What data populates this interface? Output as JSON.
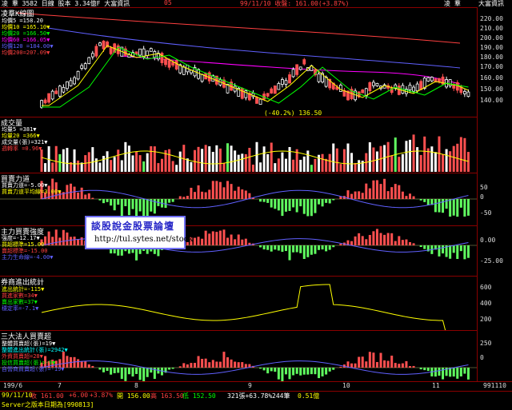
{
  "titlebar": {
    "left": "凌  羣 3582 日線 股本 3.34億F 大富資訊",
    "code": "05",
    "date_price": "99/11/10 收盤: 161.00(+3.87%)",
    "right1": "凌  羣",
    "right2": "大富資訊"
  },
  "panels": {
    "price": {
      "title": "凌羣K線圖",
      "legend": [
        {
          "text": "均價5 =158.20",
          "color": "#ffffff"
        },
        {
          "text": "均價10 =165.10▼",
          "color": "#ffff00"
        },
        {
          "text": "均價20 =166.50▼",
          "color": "#00ff00"
        },
        {
          "text": "均價60 =166.05▼",
          "color": "#ff00ff"
        },
        {
          "text": "均價120 =184.00▼",
          "color": "#6060ff"
        },
        {
          "text": "均價200=207.09▼",
          "color": "#ff4040"
        }
      ],
      "annotation": "(-40.2%) 136.50",
      "axis_ticks": [
        "220.00",
        "210.00",
        "200.00",
        "190.00",
        "180.00",
        "170.00",
        "160.00",
        "150.00",
        "140.00"
      ]
    },
    "volume": {
      "title": "成交量",
      "legend": [
        {
          "text": "均量5 =381▼",
          "color": "#ffffff"
        },
        {
          "text": "均量20 =366▼",
          "color": "#ffff00"
        },
        {
          "text": "成交量(張)=321▼",
          "color": "#ffffff"
        },
        {
          "text": "週轉率 =0.96▼",
          "color": "#ff4040"
        }
      ]
    },
    "power": {
      "title": "買賣力道",
      "legend": [
        {
          "text": "買賣力道=-5.00▼",
          "color": "#ffffff"
        },
        {
          "text": "買賣力道平均線=3.00▼",
          "color": "#ffff00"
        }
      ],
      "axis_ticks": [
        "50",
        "0",
        "-50"
      ]
    },
    "main_force": {
      "title": "主力買賣強度",
      "legend": [
        {
          "text": "強度=-12.17▼",
          "color": "#ffffff"
        },
        {
          "text": "買超標準=15.00",
          "color": "#ffff00"
        },
        {
          "text": "賣超標準=-15.00",
          "color": "#ff4040"
        },
        {
          "text": "主力生命線=-4.00▼",
          "color": "#6060ff"
        }
      ],
      "axis_ticks": [
        "0.00",
        "-25.00"
      ]
    },
    "broker": {
      "title": "券商進出統計",
      "legend": [
        {
          "text": "進出統計=-115▼",
          "color": "#ffff00"
        },
        {
          "text": "買進家數=34▼",
          "color": "#ff4040"
        },
        {
          "text": "賣出家數=37▼",
          "color": "#00ff00"
        },
        {
          "text": "穩定率=-7.1▼",
          "color": "#6060ff"
        }
      ],
      "axis_ticks": [
        "600",
        "400",
        "200"
      ]
    },
    "institution": {
      "title": "三大法人買賣超",
      "legend": [
        {
          "text": "整體買賣超(張)=19▼",
          "color": "#ffffff"
        },
        {
          "text": "整體進出統計(張)=2942▼",
          "color": "#00ffff"
        },
        {
          "text": "外資買賣超=28▼",
          "color": "#ff4040"
        },
        {
          "text": "投信買賣超(張)=-9▼",
          "color": "#00ff00"
        },
        {
          "text": "自營商買賣超(張)=-19▼",
          "color": "#6060ff"
        }
      ],
      "axis_ticks": [
        "250",
        "0"
      ]
    }
  },
  "date_axis": [
    "199/6",
    "7",
    "8",
    "9",
    "10",
    "11"
  ],
  "date_axis_right": "991110",
  "watermark": {
    "title": "談股說金股票論壇",
    "url": "http://tul.sytes.net/stock"
  },
  "statusbar": {
    "row1": [
      {
        "text": "99/11/10",
        "color": "#ffff00"
      },
      {
        "text": "收 161.00",
        "color": "#ff4040"
      },
      {
        "text": "+6.00",
        "color": "#ff4040"
      },
      {
        "text": "+3.87%",
        "color": "#ff4040"
      },
      {
        "text": "開 156.00",
        "color": "#ffff00"
      },
      {
        "text": "高 163.50",
        "color": "#ff4040"
      },
      {
        "text": "低 152.50",
        "color": "#00ff00"
      },
      {
        "text": "321張+63.78%",
        "color": "#ffffff"
      },
      {
        "text": "244筆",
        "color": "#ffffff"
      },
      {
        "text": "0.51億",
        "color": "#ffff00"
      }
    ],
    "row2": "Server之版本日期為[990813]"
  },
  "colors": {
    "up": "#ff5050",
    "down": "#ffffff",
    "green": "#60ff60",
    "border": "#8a0000",
    "ma5": "#ffffff",
    "ma10": "#ffff00",
    "ma20": "#00ff00",
    "ma60": "#ff00ff",
    "ma120": "#6060ff",
    "ma200": "#ff4040"
  }
}
